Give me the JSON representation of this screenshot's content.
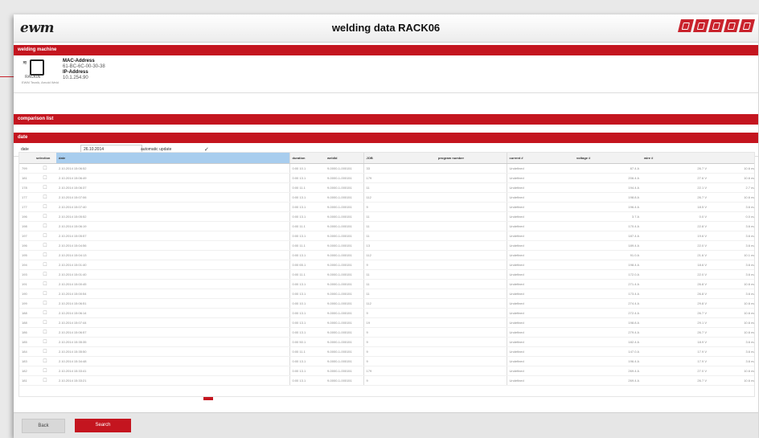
{
  "app": {
    "logo": "ewm",
    "title": "welding data RACK06",
    "brand_icons": [
      "ewm-square-icon-1",
      "ewm-square-icon-2",
      "ewm-square-icon-3",
      "ewm-square-icon-4",
      "ewm-square-icon-5"
    ]
  },
  "sections": {
    "welding_machine": "welding machine",
    "comparison_list": "comparison list",
    "date": "date"
  },
  "machine": {
    "icon": "welding-machine-icon",
    "wifi_icon": "wifi-icon",
    "mac_label": "MAC-Address",
    "mac_value": "61-BC-6C-00-30-38",
    "ip_label": "IP-Address",
    "ip_value": "10.1.254.90",
    "name": "RACK06",
    "note": "EWM Tecnik, Arnold Weld"
  },
  "date_filter": {
    "label": "date",
    "value": "26.10.2014",
    "auto_update_label": "automatic update",
    "auto_update_checked": "✓"
  },
  "table": {
    "columns": [
      "",
      "selection",
      "date",
      "duration",
      "weldld",
      "JOB",
      "program number",
      "current #",
      "voltage #",
      "wire #"
    ],
    "rows": [
      [
        "799",
        "☐",
        "2.10.2014 15:06:52",
        "0:00 10.1",
        "9-0000-1-000151",
        "33",
        "",
        "Undefined",
        "87.4 A",
        "26.7 V",
        "10.6 m/min"
      ],
      [
        "181",
        "☐",
        "2.10.2014 15:06:49",
        "0:00 13.1",
        "9-0000-1-000151",
        "179",
        "",
        "Undefined",
        "206.4 A",
        "27.6 V",
        "10.6 m/min"
      ],
      [
        "178",
        "☐",
        "2.10.2014 15:06:37",
        "0:00 11.1",
        "9-0000-1-000151",
        "11",
        "",
        "Undefined",
        "194.4 A",
        "22.1 V",
        "2.7 m/min"
      ],
      [
        "177",
        "☐",
        "2.10.2014 15:07:06",
        "0:00 13.1",
        "9-0000-1-000151",
        "112",
        "",
        "Undefined",
        "198.8 A",
        "26.7 V",
        "10.6 m/min"
      ],
      [
        "177",
        "☐",
        "2.10.2014 15:07:40",
        "0:00 13.1",
        "9-0000-1-000151",
        "9",
        "",
        "Undefined",
        "196.4 A",
        "18.5 V",
        "3.6 m/min"
      ],
      [
        "196",
        "☐",
        "2.10.2014 15:05:52",
        "0:00 13.1",
        "9-0000-1-000151",
        "11",
        "",
        "Undefined",
        "3.7 A",
        "0.0 V",
        "0.0 m/min"
      ],
      [
        "198",
        "☐",
        "2.10.2014 15:06:19",
        "0:00 11.1",
        "9-0000-1-000151",
        "11",
        "",
        "Undefined",
        "170.4 A",
        "22.8 V",
        "3.6 m/min"
      ],
      [
        "197",
        "☐",
        "2.10.2014 15:05:57",
        "0:00 13.1",
        "9-0000-1-000151",
        "11",
        "",
        "Undefined",
        "187.4 A",
        "19.6 V",
        "3.6 m/min"
      ],
      [
        "196",
        "☐",
        "2.10.2014 15:04:56",
        "0:00 11.1",
        "9-0000-1-000151",
        "13",
        "",
        "Undefined",
        "189.4 A",
        "22.0 V",
        "3.6 m/min"
      ],
      [
        "195",
        "☐",
        "2.10.2014 15:04:13",
        "0:00 13.1",
        "9-0000-1-000151",
        "112",
        "",
        "Undefined",
        "91.0 A",
        "21.6 V",
        "10.1 m/min"
      ],
      [
        "194",
        "☐",
        "2.10.2014 15:01:40",
        "0:00 65.1",
        "9-0000-1-000151",
        "9",
        "",
        "Undefined",
        "198.4 A",
        "18.6 V",
        "3.6 m/min"
      ],
      [
        "193",
        "☐",
        "2.10.2014 15:01:40",
        "0:00 11.1",
        "9-0000-1-000151",
        "11",
        "",
        "Undefined",
        "172.0 A",
        "22.0 V",
        "3.6 m/min"
      ],
      [
        "191",
        "☐",
        "2.10.2014 15:00:45",
        "0:00 13.1",
        "9-0000-1-000151",
        "11",
        "",
        "Undefined",
        "271.4 A",
        "26.8 V",
        "10.6 m/min"
      ],
      [
        "190",
        "☐",
        "2.10.2014 15:00:54",
        "0:00 13.1",
        "9-0000-1-000151",
        "11",
        "",
        "Undefined",
        "173.4 A",
        "26.8 V",
        "3.6 m/min"
      ],
      [
        "199",
        "☐",
        "2.10.2014 15:06:51",
        "0:00 10.1",
        "9-0000-1-000151",
        "112",
        "",
        "Undefined",
        "274.4 A",
        "29.8 V",
        "10.6 m/min"
      ],
      [
        "188",
        "☐",
        "2.10.2014 15:06:14",
        "0:00 13.1",
        "9-0000-1-000151",
        "9",
        "",
        "Undefined",
        "272.4 A",
        "26.7 V",
        "10.6 m/min"
      ],
      [
        "188",
        "☐",
        "2.10.2014 15:07:44",
        "0:00 13.1",
        "9-0000-1-000151",
        "19",
        "",
        "Undefined",
        "198.8 A",
        "29.1 V",
        "10.6 m/min"
      ],
      [
        "186",
        "☐",
        "2.10.2014 15:06:57",
        "0:00 13.1",
        "9-0000-1-000151",
        "9",
        "",
        "Undefined",
        "279.4 A",
        "26.7 V",
        "10.6 m/min"
      ],
      [
        "185",
        "☐",
        "2.10.2014 15:35:35",
        "0:00 50.1",
        "9-0000-1-000151",
        "9",
        "",
        "Undefined",
        "182.4 A",
        "18.9 V",
        "3.6 m/min"
      ],
      [
        "184",
        "☐",
        "2.10.2014 15:35:50",
        "0:00 11.1",
        "9-0000-1-000151",
        "9",
        "",
        "Undefined",
        "147.0 A",
        "17.9 V",
        "3.6 m/min"
      ],
      [
        "183",
        "☐",
        "2.10.2014 15:34:48",
        "0:00 13.1",
        "9-0000-1-000151",
        "9",
        "",
        "Undefined",
        "196.4 A",
        "17.9 V",
        "3.6 m/min"
      ],
      [
        "182",
        "☐",
        "2.10.2014 15:33:41",
        "0:00 13.1",
        "9-0000-1-000151",
        "179",
        "",
        "Undefined",
        "269.4 A",
        "27.0 V",
        "10.6 m/min"
      ],
      [
        "181",
        "☐",
        "2.10.2014 15:33:21",
        "0:00 13.1",
        "9-0000-1-000151",
        "9",
        "",
        "Undefined",
        "269.4 A",
        "26.7 V",
        "10.6 m/min"
      ]
    ]
  },
  "footer": {
    "back": "Back",
    "search": "Search"
  }
}
